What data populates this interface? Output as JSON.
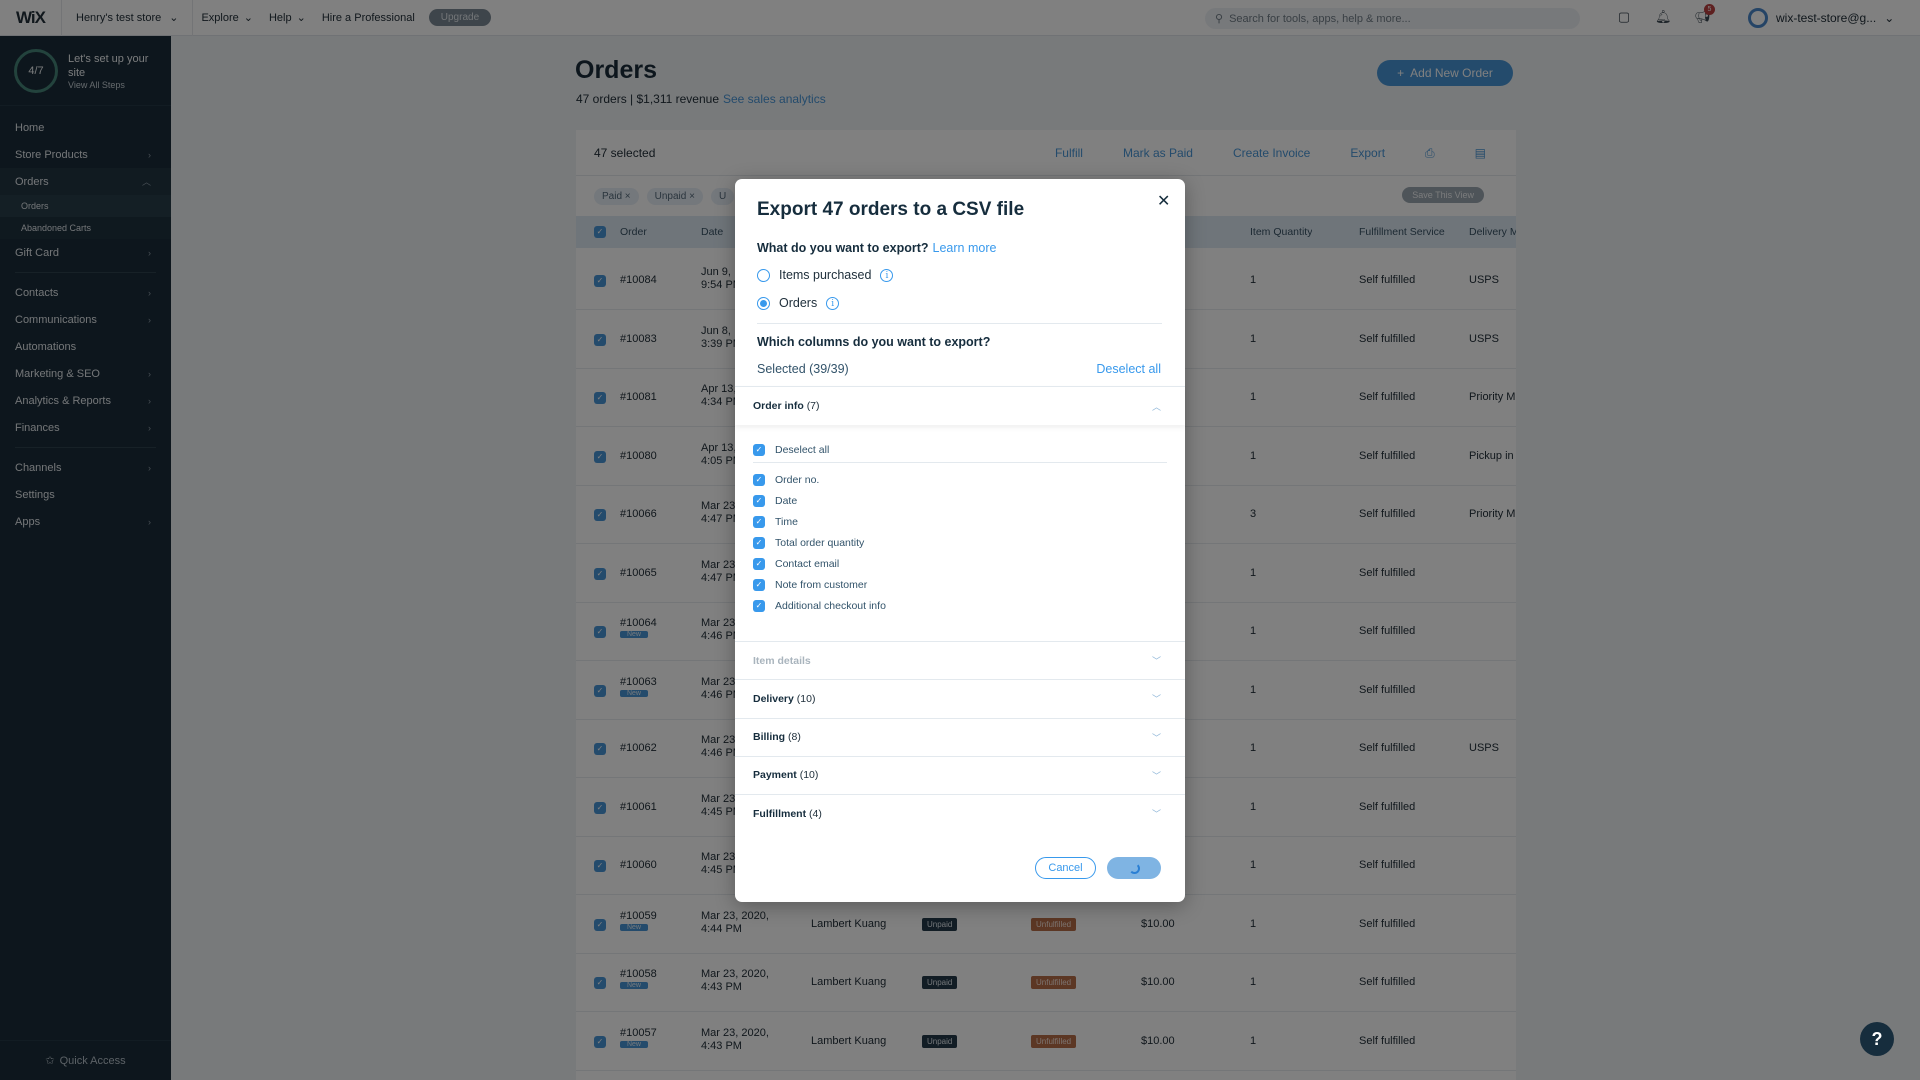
{
  "topbar": {
    "logo": "WiX",
    "site": "Henry's test store",
    "explore": "Explore",
    "help": "Help",
    "hire": "Hire a Professional",
    "upgrade": "Upgrade",
    "search_placeholder": "Search for tools, apps, help & more...",
    "notif_count": "5",
    "user": "wix-test-store@g..."
  },
  "sidebar": {
    "setup_progress": "4/7",
    "setup_title": "Let's set up your site",
    "setup_link": "View All Steps",
    "items": [
      {
        "label": "Home"
      },
      {
        "label": "Store Products"
      },
      {
        "label": "Orders"
      },
      {
        "label": "Orders"
      },
      {
        "label": "Abandoned Carts"
      },
      {
        "label": "Gift Card"
      },
      {
        "label": "Contacts"
      },
      {
        "label": "Communications"
      },
      {
        "label": "Automations"
      },
      {
        "label": "Marketing & SEO"
      },
      {
        "label": "Analytics & Reports"
      },
      {
        "label": "Finances"
      },
      {
        "label": "Channels"
      },
      {
        "label": "Settings"
      },
      {
        "label": "Apps"
      }
    ],
    "quick_access": "Quick Access"
  },
  "page": {
    "title": "Orders",
    "summary": "47 orders | $1,311 revenue",
    "analytics_link": "See sales analytics",
    "add_button": "Add New Order"
  },
  "table": {
    "selected": "47 selected",
    "actions": {
      "fulfill": "Fulfill",
      "mark_paid": "Mark as Paid",
      "invoice": "Create Invoice",
      "export": "Export"
    },
    "filters": [
      "Paid",
      "Unpaid",
      "U"
    ],
    "save_view": "Save This View",
    "headers": {
      "order": "Order",
      "date": "Date",
      "item_qty": "Item Quantity",
      "fulfillment_service": "Fulfillment Service",
      "delivery": "Delivery M"
    },
    "rows": [
      {
        "order": "#10084",
        "new": "",
        "date": "Jun 9,",
        "time": "9:54 PM",
        "customer": "",
        "payment": "",
        "fulfillment": "",
        "total": "",
        "qty": "1",
        "service": "Self fulfilled",
        "delivery": "USPS"
      },
      {
        "order": "#10083",
        "new": "",
        "date": "Jun 8,",
        "time": "3:39 PM",
        "customer": "",
        "payment": "",
        "fulfillment": "",
        "total": "",
        "qty": "1",
        "service": "Self fulfilled",
        "delivery": "USPS"
      },
      {
        "order": "#10081",
        "new": "",
        "date": "Apr 13,",
        "time": "4:34 PM",
        "customer": "",
        "payment": "",
        "fulfillment": "",
        "total": "",
        "qty": "1",
        "service": "Self fulfilled",
        "delivery": "Priority M"
      },
      {
        "order": "#10080",
        "new": "",
        "date": "Apr 13,",
        "time": "4:05 PM",
        "customer": "",
        "payment": "",
        "fulfillment": "",
        "total": "",
        "qty": "1",
        "service": "Self fulfilled",
        "delivery": "Pickup in"
      },
      {
        "order": "#10066",
        "new": "",
        "date": "Mar 23",
        "time": "4:47 PM",
        "customer": "",
        "payment": "",
        "fulfillment": "",
        "total": "",
        "qty": "3",
        "service": "Self fulfilled",
        "delivery": "Priority M"
      },
      {
        "order": "#10065",
        "new": "",
        "date": "Mar 23",
        "time": "4:47 PM",
        "customer": "",
        "payment": "",
        "fulfillment": "",
        "total": "",
        "qty": "1",
        "service": "Self fulfilled",
        "delivery": ""
      },
      {
        "order": "#10064",
        "new": "New",
        "date": "Mar 23",
        "time": "4:46 PM",
        "customer": "",
        "payment": "",
        "fulfillment": "",
        "total": "",
        "qty": "1",
        "service": "Self fulfilled",
        "delivery": ""
      },
      {
        "order": "#10063",
        "new": "New",
        "date": "Mar 23",
        "time": "4:46 PM",
        "customer": "",
        "payment": "",
        "fulfillment": "",
        "total": "",
        "qty": "1",
        "service": "Self fulfilled",
        "delivery": ""
      },
      {
        "order": "#10062",
        "new": "",
        "date": "Mar 23",
        "time": "4:46 PM",
        "customer": "",
        "payment": "",
        "fulfillment": "",
        "total": "",
        "qty": "1",
        "service": "Self fulfilled",
        "delivery": "USPS"
      },
      {
        "order": "#10061",
        "new": "",
        "date": "Mar 23",
        "time": "4:45 PM",
        "customer": "",
        "payment": "",
        "fulfillment": "",
        "total": "",
        "qty": "1",
        "service": "Self fulfilled",
        "delivery": ""
      },
      {
        "order": "#10060",
        "new": "",
        "date": "Mar 23",
        "time": "4:45 PM",
        "customer": "",
        "payment": "",
        "fulfillment": "",
        "total": "",
        "qty": "1",
        "service": "Self fulfilled",
        "delivery": ""
      },
      {
        "order": "#10059",
        "new": "New",
        "date": "Mar 23, 2020,",
        "time": "4:44 PM",
        "customer": "Lambert Kuang",
        "payment": "Unpaid",
        "fulfillment": "Unfulfilled",
        "total": "$10.00",
        "qty": "1",
        "service": "Self fulfilled",
        "delivery": ""
      },
      {
        "order": "#10058",
        "new": "New",
        "date": "Mar 23, 2020,",
        "time": "4:43 PM",
        "customer": "Lambert Kuang",
        "payment": "Unpaid",
        "fulfillment": "Unfulfilled",
        "total": "$10.00",
        "qty": "1",
        "service": "Self fulfilled",
        "delivery": ""
      },
      {
        "order": "#10057",
        "new": "New",
        "date": "Mar 23, 2020,",
        "time": "4:43 PM",
        "customer": "Lambert Kuang",
        "payment": "Unpaid",
        "fulfillment": "Unfulfilled",
        "total": "$10.00",
        "qty": "1",
        "service": "Self fulfilled",
        "delivery": ""
      }
    ]
  },
  "modal": {
    "title": "Export 47 orders to a CSV file",
    "q1": "What do you want to export?",
    "learn_more": "Learn more",
    "opt_items": "Items purchased",
    "opt_orders": "Orders",
    "selected_option": "Orders",
    "q2": "Which columns do you want to export?",
    "selected_count": "Selected (39/39)",
    "deselect_all": "Deselect all",
    "order_info": {
      "title": "Order info",
      "count": "(7)",
      "deselect_all": "Deselect all",
      "columns": [
        "Order no.",
        "Date",
        "Time",
        "Total order quantity",
        "Contact email",
        "Note from customer",
        "Additional checkout info"
      ]
    },
    "sections": [
      {
        "title": "Item details",
        "count": ""
      },
      {
        "title": "Delivery",
        "count": "(10)"
      },
      {
        "title": "Billing",
        "count": "(8)"
      },
      {
        "title": "Payment",
        "count": "(10)"
      },
      {
        "title": "Fulfillment",
        "count": "(4)"
      }
    ],
    "cancel": "Cancel"
  },
  "help": "?",
  "colors": {
    "accent": "#3899ec",
    "sidebar": "#162d3d",
    "unfulfilled": "#c86a3c"
  }
}
